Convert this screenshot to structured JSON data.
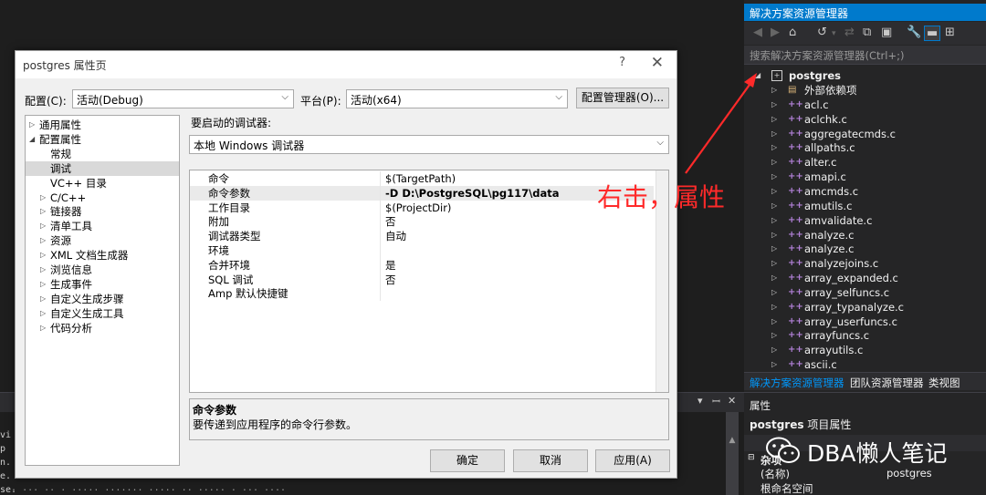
{
  "ide": {
    "left_text": "vi\np\nn. c\ne. c\nse.\ns. c",
    "bottom_text": "... ... .. . ..... ....... ..... .. ..... . ... ...."
  },
  "dialog": {
    "title": "postgres 属性页",
    "help_label": "?",
    "close_label": "✕",
    "config_label": "配置(C):",
    "config_value": "活动(Debug)",
    "platform_label": "平台(P):",
    "platform_value": "活动(x64)",
    "config_manager_label": "配置管理器(O)...",
    "tree": [
      {
        "label": "通用属性",
        "toggle": "▷",
        "indent": 0
      },
      {
        "label": "配置属性",
        "toggle": "◢",
        "indent": 0
      },
      {
        "label": "常规",
        "toggle": "",
        "indent": 1
      },
      {
        "label": "调试",
        "toggle": "",
        "indent": 1,
        "selected": true
      },
      {
        "label": "VC++ 目录",
        "toggle": "",
        "indent": 1
      },
      {
        "label": "C/C++",
        "toggle": "▷",
        "indent": 1
      },
      {
        "label": "链接器",
        "toggle": "▷",
        "indent": 1
      },
      {
        "label": "清单工具",
        "toggle": "▷",
        "indent": 1
      },
      {
        "label": "资源",
        "toggle": "▷",
        "indent": 1
      },
      {
        "label": "XML 文档生成器",
        "toggle": "▷",
        "indent": 1
      },
      {
        "label": "浏览信息",
        "toggle": "▷",
        "indent": 1
      },
      {
        "label": "生成事件",
        "toggle": "▷",
        "indent": 1
      },
      {
        "label": "自定义生成步骤",
        "toggle": "▷",
        "indent": 1
      },
      {
        "label": "自定义生成工具",
        "toggle": "▷",
        "indent": 1
      },
      {
        "label": "代码分析",
        "toggle": "▷",
        "indent": 1
      }
    ],
    "debugger_label": "要启动的调试器:",
    "debugger_value": "本地 Windows 调试器",
    "grid": [
      {
        "name": "命令",
        "value": "$(TargetPath)"
      },
      {
        "name": "命令参数",
        "value": "-D D:\\PostgreSQL\\pg117\\data",
        "selected": true
      },
      {
        "name": "工作目录",
        "value": "$(ProjectDir)"
      },
      {
        "name": "附加",
        "value": "否"
      },
      {
        "name": "调试器类型",
        "value": "自动"
      },
      {
        "name": "环境",
        "value": ""
      },
      {
        "name": "合并环境",
        "value": "是"
      },
      {
        "name": "SQL 调试",
        "value": "否"
      },
      {
        "name": "Amp 默认快捷键",
        "value": ""
      }
    ],
    "desc_title": "命令参数",
    "desc_text": "要传递到应用程序的命令行参数。",
    "ok_label": "确定",
    "cancel_label": "取消",
    "apply_label": "应用(A)"
  },
  "solution_explorer": {
    "title": "解决方案资源管理器",
    "search_placeholder": "搜索解决方案资源管理器(Ctrl+;)",
    "root": "postgres",
    "items": [
      {
        "label": "外部依赖项",
        "kind": "folder"
      },
      {
        "label": "acl.c",
        "kind": "file"
      },
      {
        "label": "aclchk.c",
        "kind": "file"
      },
      {
        "label": "aggregatecmds.c",
        "kind": "file"
      },
      {
        "label": "allpaths.c",
        "kind": "file"
      },
      {
        "label": "alter.c",
        "kind": "file"
      },
      {
        "label": "amapi.c",
        "kind": "file"
      },
      {
        "label": "amcmds.c",
        "kind": "file"
      },
      {
        "label": "amutils.c",
        "kind": "file"
      },
      {
        "label": "amvalidate.c",
        "kind": "file"
      },
      {
        "label": "analyze.c",
        "kind": "file"
      },
      {
        "label": "analyze.c",
        "kind": "file"
      },
      {
        "label": "analyzejoins.c",
        "kind": "file"
      },
      {
        "label": "array_expanded.c",
        "kind": "file"
      },
      {
        "label": "array_selfuncs.c",
        "kind": "file"
      },
      {
        "label": "array_typanalyze.c",
        "kind": "file"
      },
      {
        "label": "array_userfuncs.c",
        "kind": "file"
      },
      {
        "label": "arrayfuncs.c",
        "kind": "file"
      },
      {
        "label": "arrayutils.c",
        "kind": "file"
      },
      {
        "label": "ascii.c",
        "kind": "file"
      }
    ],
    "tabs": [
      "解决方案资源管理器",
      "团队资源管理器",
      "类视图"
    ]
  },
  "properties": {
    "title": "属性",
    "subject": "postgres",
    "subject_suffix": " 项目属性",
    "section": "杂项",
    "rows": [
      {
        "k": "(名称)",
        "v": "postgres"
      },
      {
        "k": "根命名空间",
        "v": ""
      }
    ]
  },
  "annotation": {
    "text": "右击，属性",
    "color": "#ff2a2a"
  },
  "watermark": {
    "text": "DBA懒人笔记"
  },
  "colors": {
    "accent": "#007acc",
    "panel": "#252526",
    "annotation": "#ff2a2a"
  }
}
